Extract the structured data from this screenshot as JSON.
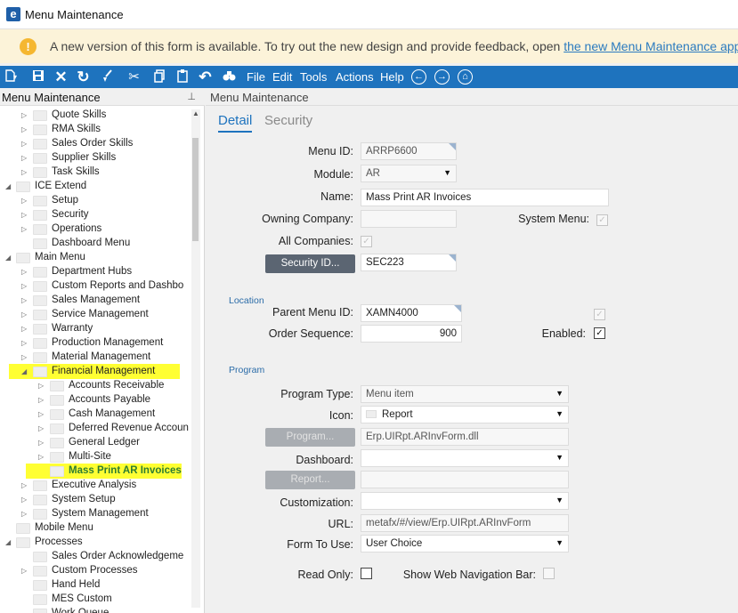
{
  "window": {
    "title": "Menu Maintenance",
    "logo_letter": "e"
  },
  "banner": {
    "icon": "!",
    "text": "A new version of this form is available. To try out the new design and provide feedback, open ",
    "link": "the new Menu Maintenance app",
    "suffix": "."
  },
  "toolbar": {
    "menus": [
      "File",
      "Edit",
      "Tools",
      "Actions",
      "Help"
    ],
    "icons": [
      "new-icon",
      "save-icon",
      "delete-icon",
      "refresh-icon",
      "clear-icon",
      "cut-icon",
      "copy-icon",
      "paste-icon",
      "undo-icon",
      "search-icon",
      "back-icon",
      "forward-icon",
      "home-icon"
    ]
  },
  "tree": {
    "title": "Menu Maintenance",
    "pin": "📌",
    "items": [
      {
        "label": "Quote Skills",
        "level": 2,
        "arrow": "▷"
      },
      {
        "label": "RMA Skills",
        "level": 2,
        "arrow": "▷"
      },
      {
        "label": "Sales Order Skills",
        "level": 2,
        "arrow": "▷"
      },
      {
        "label": "Supplier Skills",
        "level": 2,
        "arrow": "▷"
      },
      {
        "label": "Task Skills",
        "level": 2,
        "arrow": "▷"
      },
      {
        "label": "ICE Extend",
        "level": 1,
        "arrow": "◢"
      },
      {
        "label": "Setup",
        "level": 2,
        "arrow": "▷"
      },
      {
        "label": "Security",
        "level": 2,
        "arrow": "▷"
      },
      {
        "label": "Operations",
        "level": 2,
        "arrow": "▷"
      },
      {
        "label": "Dashboard Menu",
        "level": 2,
        "arrow": ""
      },
      {
        "label": "Main Menu",
        "level": 1,
        "arrow": "◢"
      },
      {
        "label": "Department Hubs",
        "level": 2,
        "arrow": "▷"
      },
      {
        "label": "Custom Reports and Dashbo",
        "level": 2,
        "arrow": "▷"
      },
      {
        "label": "Sales Management",
        "level": 2,
        "arrow": "▷"
      },
      {
        "label": "Service Management",
        "level": 2,
        "arrow": "▷"
      },
      {
        "label": "Warranty",
        "level": 2,
        "arrow": "▷"
      },
      {
        "label": "Production Management",
        "level": 2,
        "arrow": "▷"
      },
      {
        "label": "Material Management",
        "level": 2,
        "arrow": "▷"
      },
      {
        "label": "Financial Management",
        "level": 2,
        "arrow": "◢",
        "highlight": true
      },
      {
        "label": "Accounts Receivable",
        "level": 3,
        "arrow": "▷"
      },
      {
        "label": "Accounts Payable",
        "level": 3,
        "arrow": "▷"
      },
      {
        "label": "Cash Management",
        "level": 3,
        "arrow": "▷"
      },
      {
        "label": "Deferred Revenue Accoun",
        "level": 3,
        "arrow": "▷"
      },
      {
        "label": "General Ledger",
        "level": 3,
        "arrow": "▷"
      },
      {
        "label": "Multi-Site",
        "level": 3,
        "arrow": "▷"
      },
      {
        "label": "Mass Print AR Invoices",
        "level": 3,
        "arrow": "",
        "highlight": true,
        "selected": true
      },
      {
        "label": "Executive Analysis",
        "level": 2,
        "arrow": "▷"
      },
      {
        "label": "System Setup",
        "level": 2,
        "arrow": "▷"
      },
      {
        "label": "System Management",
        "level": 2,
        "arrow": "▷"
      },
      {
        "label": "Mobile Menu",
        "level": 1,
        "arrow": ""
      },
      {
        "label": "Processes",
        "level": 1,
        "arrow": "◢"
      },
      {
        "label": "Sales Order Acknowledgeme",
        "level": 2,
        "arrow": ""
      },
      {
        "label": "Custom Processes",
        "level": 2,
        "arrow": "▷"
      },
      {
        "label": "Hand Held",
        "level": 2,
        "arrow": ""
      },
      {
        "label": "MES Custom",
        "level": 2,
        "arrow": ""
      },
      {
        "label": "Work Queue",
        "level": 2,
        "arrow": ""
      }
    ]
  },
  "content": {
    "title": "Menu Maintenance",
    "tabs": [
      "Detail",
      "Security"
    ],
    "fields": {
      "menu_id_label": "Menu ID:",
      "menu_id": "ARRP6600",
      "module_label": "Module:",
      "module": "AR",
      "name_label": "Name:",
      "name": "Mass Print AR Invoices",
      "owning_company_label": "Owning Company:",
      "owning_company": "",
      "system_menu_label": "System Menu:",
      "system_menu_checked": true,
      "all_companies_label": "All Companies:",
      "all_companies_checked": true,
      "security_button": "Security ID...",
      "security_id": "SEC223"
    },
    "location": {
      "section": "Location",
      "parent_label": "Parent Menu ID:",
      "parent": "XAMN4000",
      "order_label": "Order Sequence:",
      "order": "900",
      "enabled_label": "Enabled:",
      "enabled_checked": true,
      "top_checkbox_checked": true
    },
    "program": {
      "section": "Program",
      "type_label": "Program Type:",
      "type": "Menu item",
      "icon_label": "Icon:",
      "icon": "Report",
      "program_button": "Program...",
      "program_value": "Erp.UIRpt.ARInvForm.dll",
      "dashboard_label": "Dashboard:",
      "dashboard": "",
      "report_button": "Report...",
      "report_value": "",
      "customization_label": "Customization:",
      "customization": "",
      "url_label": "URL:",
      "url": "metafx/#/view/Erp.UIRpt.ARInvForm",
      "form_label": "Form To Use:",
      "form": "User Choice",
      "readonly_label": "Read Only:",
      "readonly_checked": false,
      "webnav_label": "Show Web Navigation Bar:",
      "webnav_checked": false
    }
  }
}
